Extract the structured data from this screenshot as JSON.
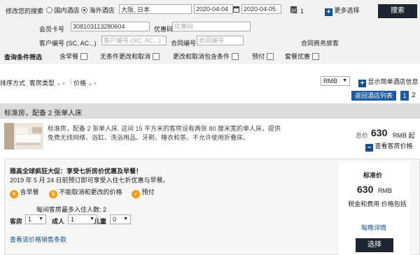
{
  "search": {
    "label": "修改您的搜索",
    "domestic_label": "国内酒店",
    "overseas_label": "海外酒店",
    "destination": "大阪, 日本",
    "checkin": "2020-04-04",
    "checkout": "2020-04-05",
    "nights": "晚: 1",
    "more_options": "更多选择",
    "search_button": "搜索",
    "member_label": "会员卡号",
    "member_value": "308103113280604",
    "promo_label": "优惠码",
    "promo_placeholder": "优惠码",
    "client_code_label": "客户编号 (SC, AC...)",
    "client_code_placeholder": "客户编号 (SC, AC...)",
    "contract_label": "合同编号",
    "contract_placeholder": "合同编号",
    "corporate_label": "合同商务旅客"
  },
  "filters": {
    "label": "查询条件筛选",
    "items": [
      "含早餐",
      "无条件更改和取消",
      "更改和取消包含条件",
      "预付",
      "套餐优惠"
    ]
  },
  "sort": {
    "label": "排序方式",
    "room_type": "客房类型",
    "price": "价格",
    "currency": "RMB",
    "show_simple": "显示简单酒店信息",
    "back_to_list": "返回酒店列表",
    "pages": [
      "1",
      "2"
    ]
  },
  "room": {
    "title": "标准房，配备 2 张单人床",
    "description": "标准房，配备 2 张单人床. 这间 15 平方米的客房设有两张 80 厘米宽的单人床，提供免费无线网络、浴缸、洗浴用品、牙刷、睡衣和茶。不允许使用折叠床。",
    "total_label": "总价",
    "total_price": "630",
    "total_unit": "RMB 起",
    "view_prices": "查看客房价格"
  },
  "rate": {
    "promo_title": "雅高全球疯狂大促：享受七折房价优惠及早餐！",
    "promo_desc": "2019 年 5 月 24 日前预订即可享受入住七折优惠与早餐。",
    "features": [
      "含早餐",
      "不能取消和更改的价格",
      "预付"
    ],
    "max_guests": "每间客房最多入住人数: 2",
    "rooms_label": "客房",
    "rooms_value": "1",
    "adults_label": "成人",
    "adults_value": "1",
    "children_label": "儿童",
    "children_value": "0",
    "view_terms": "查看该价格销售条款",
    "rate_name": "标准价",
    "price": "630",
    "price_unit": "RMB",
    "tax_note": "税金和费用 价格包括",
    "details_link": "每晚详情",
    "select_button": "选择"
  }
}
